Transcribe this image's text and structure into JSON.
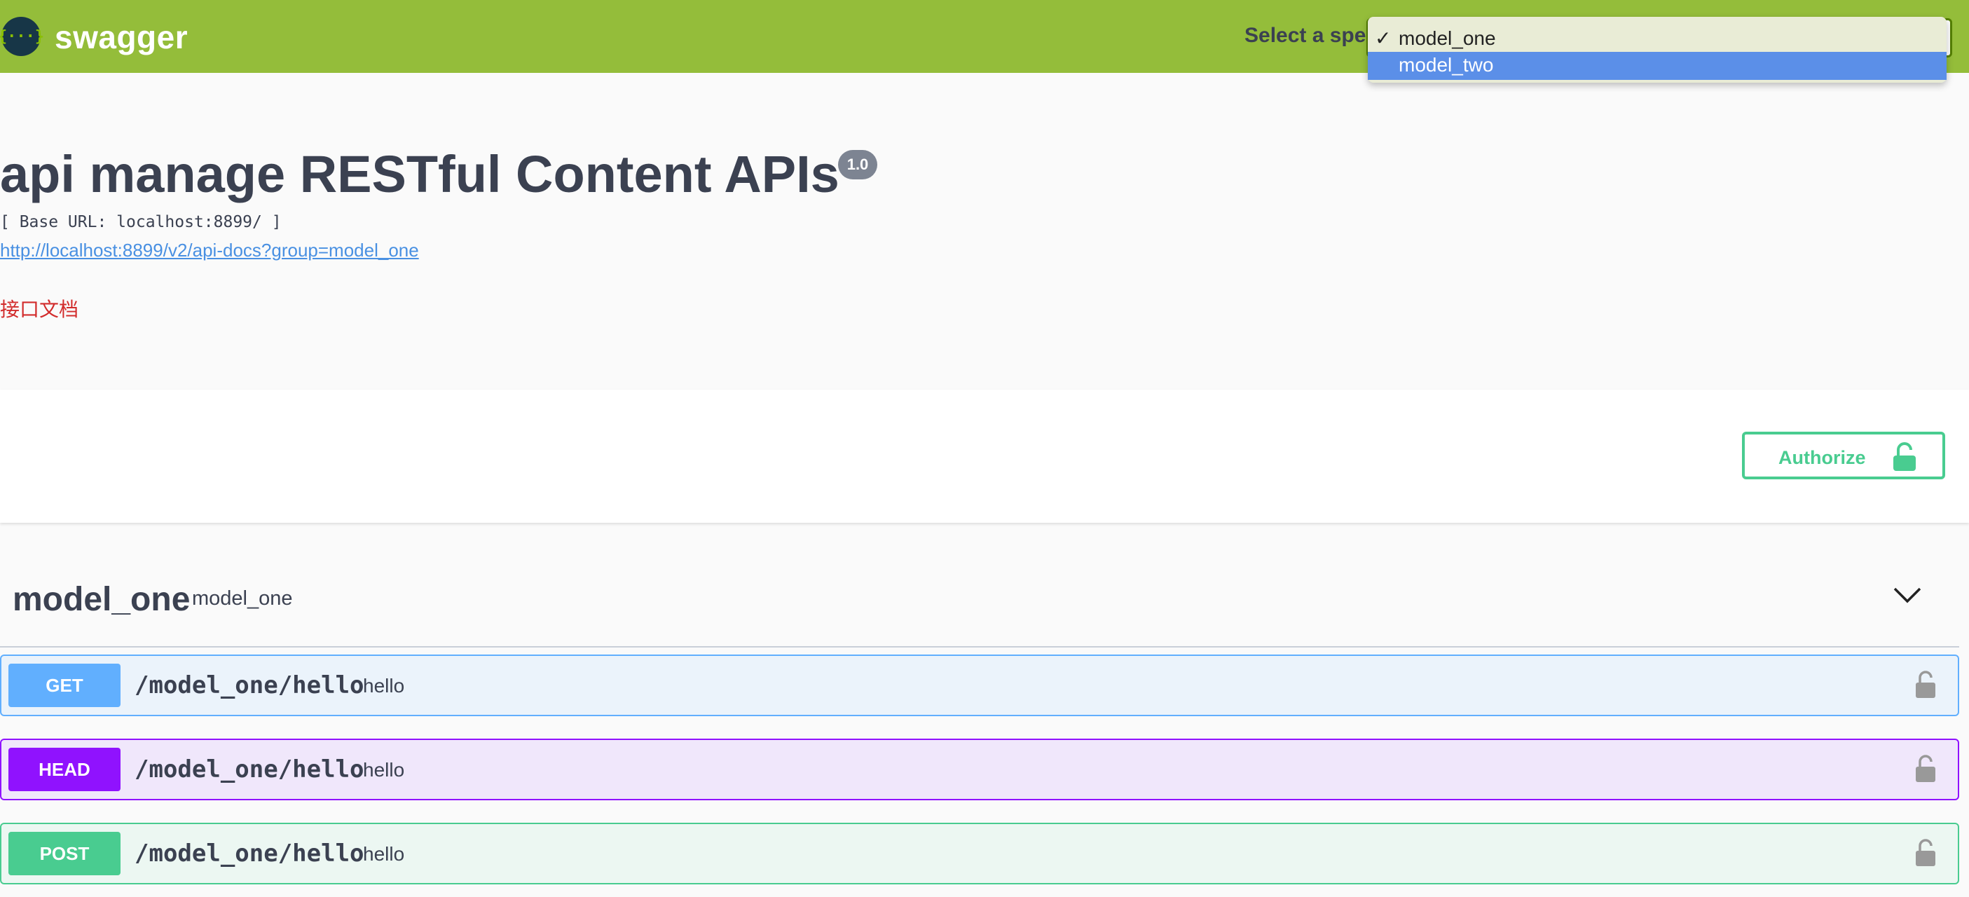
{
  "topbar": {
    "logo_glyph": "{···}",
    "logo_text": "swagger",
    "spec_label": "Select a spec",
    "dropdown": {
      "options": [
        {
          "label": "model_one",
          "checked": true
        },
        {
          "label": "model_two",
          "highlighted": true
        }
      ],
      "check_glyph": "✓"
    }
  },
  "info": {
    "title": "api manage RESTful Content APIs",
    "version": "1.0",
    "base_url": "[ Base URL: localhost:8899/ ]",
    "docs_link": "http://localhost:8899/v2/api-docs?group=model_one",
    "description": "接口文档"
  },
  "auth": {
    "authorize_label": "Authorize"
  },
  "tag": {
    "name": "model_one",
    "description": "model_one"
  },
  "operations": [
    {
      "method": "GET",
      "path": "/model_one/hello",
      "summary": "hello"
    },
    {
      "method": "HEAD",
      "path": "/model_one/hello",
      "summary": "hello"
    },
    {
      "method": "POST",
      "path": "/model_one/hello",
      "summary": "hello"
    }
  ],
  "colors": {
    "topbar": "#94bd3a",
    "get": "#61affe",
    "head": "#9012fe",
    "post": "#49cc90",
    "authorize": "#49cc90",
    "description_text": "#d22c2c",
    "link": "#4990e2"
  }
}
